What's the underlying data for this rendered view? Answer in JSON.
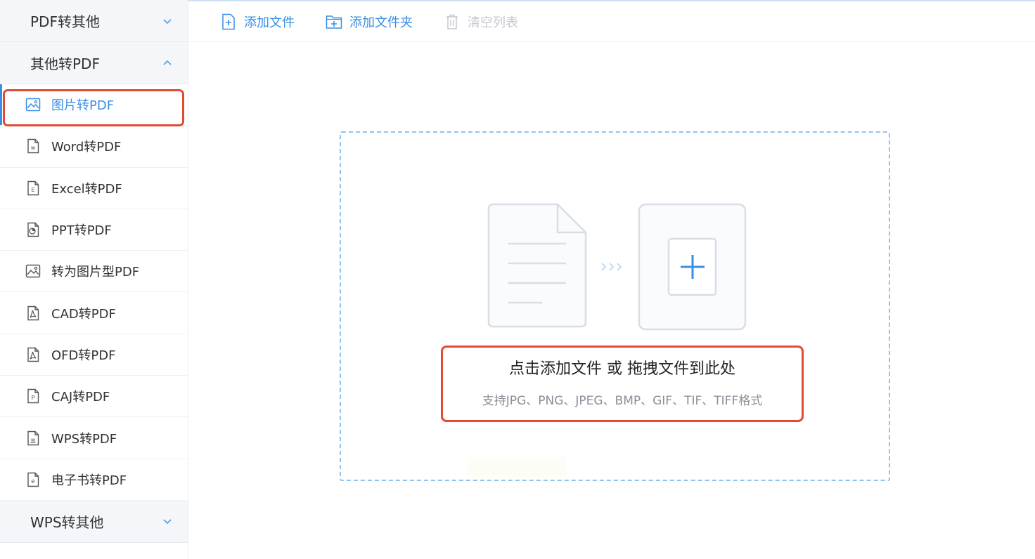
{
  "sidebar": {
    "group_pdf_to_other": "PDF转其他",
    "group_other_to_pdf": "其他转PDF",
    "items": [
      {
        "label": "图片转PDF",
        "icon": "image-icon"
      },
      {
        "label": "Word转PDF",
        "icon": "word-file-icon"
      },
      {
        "label": "Excel转PDF",
        "icon": "excel-file-icon"
      },
      {
        "label": "PPT转PDF",
        "icon": "ppt-file-icon"
      },
      {
        "label": "转为图片型PDF",
        "icon": "image-icon"
      },
      {
        "label": "CAD转PDF",
        "icon": "pdf-file-icon"
      },
      {
        "label": "OFD转PDF",
        "icon": "pdf-file-icon"
      },
      {
        "label": "CAJ转PDF",
        "icon": "caj-file-icon"
      },
      {
        "label": "WPS转PDF",
        "icon": "wps-file-icon"
      },
      {
        "label": "电子书转PDF",
        "icon": "ebook-file-icon"
      }
    ],
    "group_wps_to_other": "WPS转其他"
  },
  "toolbar": {
    "add_file": "添加文件",
    "add_folder": "添加文件夹",
    "clear_list": "清空列表"
  },
  "dropzone": {
    "main_hint": "点击添加文件 或 拖拽文件到此处",
    "sub_hint": "支持JPG、PNG、JPEG、BMP、GIF、TIF、TIFF格式"
  },
  "colors": {
    "accent": "#3a8ee6",
    "highlight_border": "#e04b36",
    "sidebar_group_bg": "#f4f6f9"
  }
}
